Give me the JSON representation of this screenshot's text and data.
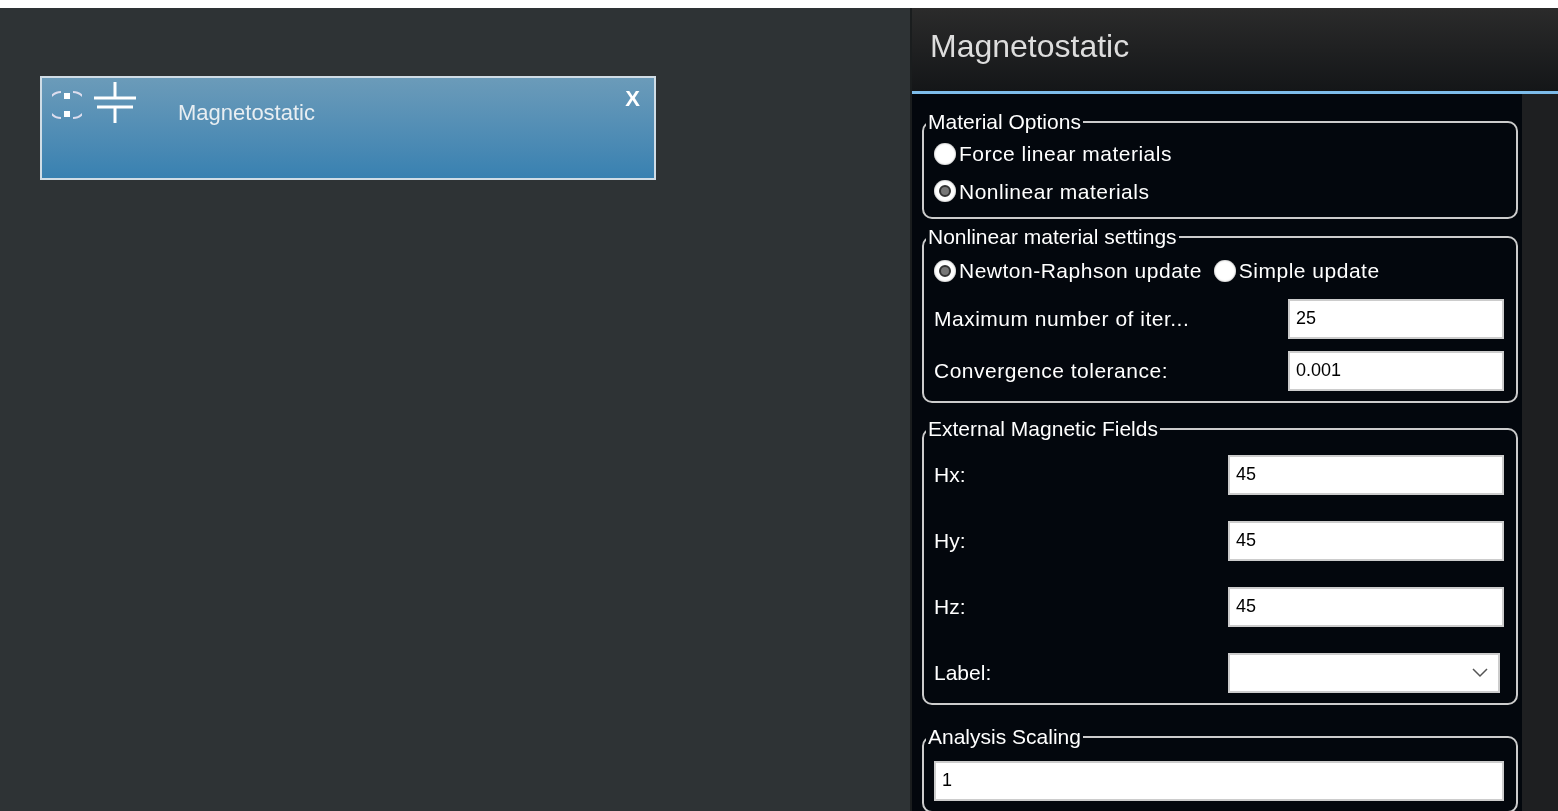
{
  "node": {
    "title": "Magnetostatic",
    "close": "X"
  },
  "panel": {
    "title": "Magnetostatic",
    "groups": [
      {
        "title": "Material Options",
        "items": [
          {
            "kind": "radio-column",
            "options": [
              {
                "label": "Force linear materials",
                "selected": false
              },
              {
                "label": "Nonlinear materials",
                "selected": true
              }
            ]
          }
        ]
      },
      {
        "title": "Nonlinear material settings",
        "items": [
          {
            "kind": "radio-row",
            "options": [
              {
                "label": "Newton-Raphson update",
                "selected": true
              },
              {
                "label": "Simple update",
                "selected": false
              }
            ]
          },
          {
            "kind": "field",
            "label": "Maximum number of iter...",
            "value": "25"
          },
          {
            "kind": "field",
            "label": "Convergence tolerance:",
            "value": "0.001"
          }
        ]
      },
      {
        "title": "External Magnetic Fields",
        "items": [
          {
            "kind": "wide-label-field",
            "label": "Hx:",
            "value": "45"
          },
          {
            "kind": "wide-label-field",
            "label": "Hy:",
            "value": "45"
          },
          {
            "kind": "wide-label-field",
            "label": "Hz:",
            "value": "45"
          },
          {
            "kind": "select",
            "label": "Label:"
          }
        ]
      },
      {
        "title": "Analysis Scaling",
        "items": [
          {
            "kind": "full-field",
            "value": "1"
          }
        ]
      }
    ]
  }
}
